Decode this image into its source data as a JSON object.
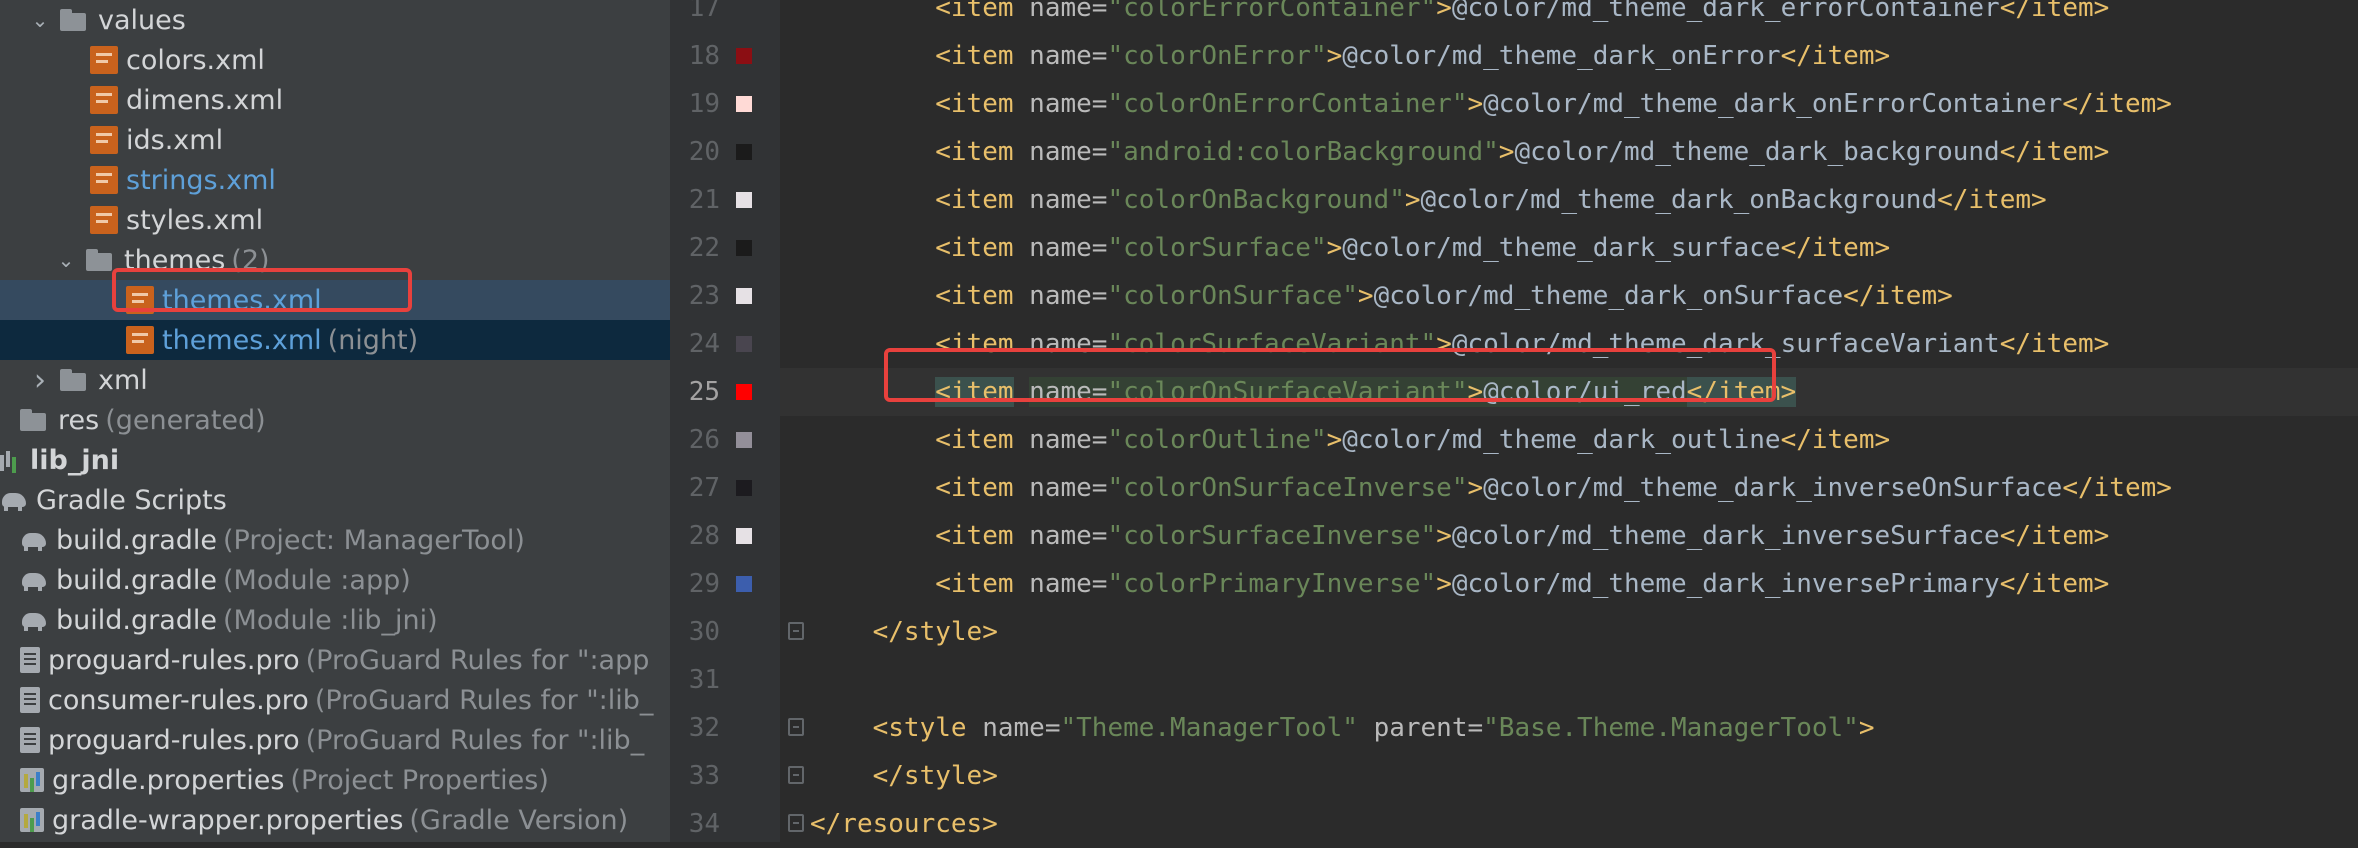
{
  "project_tree": {
    "items": [
      {
        "label": "values",
        "hint": "",
        "icon": "folder-icon",
        "arrow": "expanded",
        "style": "normal"
      },
      {
        "label": "colors.xml",
        "hint": "",
        "icon": "xml-file-icon",
        "arrow": "",
        "style": "normal"
      },
      {
        "label": "dimens.xml",
        "hint": "",
        "icon": "xml-file-icon",
        "arrow": "",
        "style": "normal"
      },
      {
        "label": "ids.xml",
        "hint": "",
        "icon": "xml-file-icon",
        "arrow": "",
        "style": "normal"
      },
      {
        "label": "strings.xml",
        "hint": "",
        "icon": "xml-file-icon",
        "arrow": "",
        "style": "blue"
      },
      {
        "label": "styles.xml",
        "hint": "",
        "icon": "xml-file-icon",
        "arrow": "",
        "style": "normal"
      },
      {
        "label": "themes",
        "hint": "(2)",
        "icon": "folder-icon",
        "arrow": "expanded",
        "style": "normal"
      },
      {
        "label": "themes.xml",
        "hint": "",
        "icon": "xml-file-icon",
        "arrow": "",
        "style": "blue"
      },
      {
        "label": "themes.xml",
        "hint": "(night)",
        "icon": "xml-file-icon",
        "arrow": "",
        "style": "blue"
      },
      {
        "label": "xml",
        "hint": "",
        "icon": "folder-icon",
        "arrow": "collapsed",
        "style": "normal"
      },
      {
        "label": "res",
        "hint": "(generated)",
        "icon": "folder-icon",
        "arrow": "",
        "style": "normal"
      },
      {
        "label": "lib_jni",
        "hint": "",
        "icon": "module-icon",
        "arrow": "",
        "style": "bold"
      },
      {
        "label": "Gradle Scripts",
        "hint": "",
        "icon": "gradle-icon",
        "arrow": "",
        "style": "normal"
      },
      {
        "label": "build.gradle",
        "hint": "(Project: ManagerTool)",
        "icon": "gradle-icon",
        "arrow": "",
        "style": "normal"
      },
      {
        "label": "build.gradle",
        "hint": "(Module :app)",
        "icon": "gradle-icon",
        "arrow": "",
        "style": "normal"
      },
      {
        "label": "build.gradle",
        "hint": "(Module :lib_jni)",
        "icon": "gradle-icon",
        "arrow": "",
        "style": "normal"
      },
      {
        "label": "proguard-rules.pro",
        "hint": "(ProGuard Rules for \":app",
        "icon": "file-icon",
        "arrow": "",
        "style": "normal"
      },
      {
        "label": "consumer-rules.pro",
        "hint": "(ProGuard Rules for \":lib_",
        "icon": "file-icon",
        "arrow": "",
        "style": "normal"
      },
      {
        "label": "proguard-rules.pro",
        "hint": "(ProGuard Rules for \":lib_",
        "icon": "file-icon",
        "arrow": "",
        "style": "normal"
      },
      {
        "label": "gradle.properties",
        "hint": "(Project Properties)",
        "icon": "properties-icon",
        "arrow": "",
        "style": "normal"
      },
      {
        "label": "gradle-wrapper.properties",
        "hint": "(Gradle Version)",
        "icon": "properties-icon",
        "arrow": "",
        "style": "normal"
      }
    ]
  },
  "editor": {
    "lines": [
      {
        "num": "17",
        "swatch": "",
        "kind": "item",
        "name": "colorErrorContainer",
        "value": "@color/md_theme_dark_errorContainer"
      },
      {
        "num": "18",
        "swatch": "#8b0e13",
        "kind": "item",
        "name": "colorOnError",
        "value": "@color/md_theme_dark_onError"
      },
      {
        "num": "19",
        "swatch": "#ffdad6",
        "kind": "item",
        "name": "colorOnErrorContainer",
        "value": "@color/md_theme_dark_onErrorContainer"
      },
      {
        "num": "20",
        "swatch": "#1b1b1b",
        "kind": "item",
        "name": "android:colorBackground",
        "value": "@color/md_theme_dark_background"
      },
      {
        "num": "21",
        "swatch": "#e6e1e5",
        "kind": "item",
        "name": "colorOnBackground",
        "value": "@color/md_theme_dark_onBackground"
      },
      {
        "num": "22",
        "swatch": "#1b1b1b",
        "kind": "item",
        "name": "colorSurface",
        "value": "@color/md_theme_dark_surface"
      },
      {
        "num": "23",
        "swatch": "#e6e1e5",
        "kind": "item",
        "name": "colorOnSurface",
        "value": "@color/md_theme_dark_onSurface"
      },
      {
        "num": "24",
        "swatch": "#49454f",
        "kind": "item",
        "name": "colorSurfaceVariant",
        "value": "@color/md_theme_dark_surfaceVariant"
      },
      {
        "num": "25",
        "swatch": "#ff0000",
        "kind": "item",
        "name": "colorOnSurfaceVariant",
        "value": "@color/ui_red"
      },
      {
        "num": "26",
        "swatch": "#938f99",
        "kind": "item",
        "name": "colorOutline",
        "value": "@color/md_theme_dark_outline"
      },
      {
        "num": "27",
        "swatch": "#1c1b1f",
        "kind": "item",
        "name": "colorOnSurfaceInverse",
        "value": "@color/md_theme_dark_inverseOnSurface"
      },
      {
        "num": "28",
        "swatch": "#e6e1e5",
        "kind": "item",
        "name": "colorSurfaceInverse",
        "value": "@color/md_theme_dark_inverseSurface"
      },
      {
        "num": "29",
        "swatch": "#3c5ead",
        "kind": "item",
        "name": "colorPrimaryInverse",
        "value": "@color/md_theme_dark_inversePrimary"
      },
      {
        "num": "30",
        "swatch": "",
        "kind": "close-style",
        "indent": "    ",
        "text": "</style>"
      },
      {
        "num": "31",
        "swatch": "",
        "kind": "blank"
      },
      {
        "num": "32",
        "swatch": "",
        "kind": "style-open",
        "indent": "    ",
        "name": "Theme.ManagerTool",
        "parent": "Base.Theme.ManagerTool"
      },
      {
        "num": "33",
        "swatch": "",
        "kind": "close-style",
        "indent": "    ",
        "text": "</style>"
      },
      {
        "num": "34",
        "swatch": "",
        "kind": "close-style",
        "indent": "",
        "text": "</resources>"
      }
    ],
    "active_line": "25"
  },
  "colors": {
    "highlight_border": "#e8413d",
    "tag": "#e8bf6a",
    "attr_value": "#6a8759",
    "selection": "#0d293e"
  }
}
